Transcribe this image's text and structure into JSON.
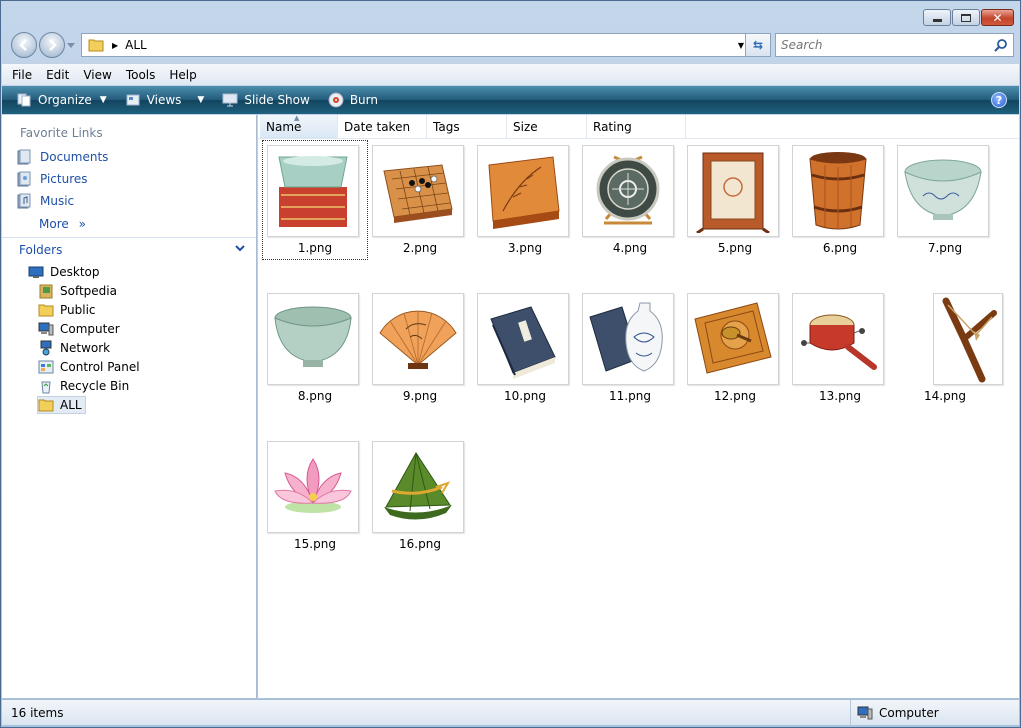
{
  "address": {
    "path": "ALL"
  },
  "search": {
    "placeholder": "Search"
  },
  "menu": [
    "File",
    "Edit",
    "View",
    "Tools",
    "Help"
  ],
  "toolbar": {
    "organize": "Organize",
    "views": "Views",
    "slideshow": "Slide Show",
    "burn": "Burn"
  },
  "favorites": {
    "title": "Favorite Links",
    "items": [
      {
        "label": "Documents",
        "icon": "documents-icon"
      },
      {
        "label": "Pictures",
        "icon": "pictures-icon"
      },
      {
        "label": "Music",
        "icon": "music-icon"
      }
    ],
    "more": "More"
  },
  "folders": {
    "title": "Folders",
    "tree": [
      {
        "label": "Desktop",
        "icon": "desktop-icon"
      },
      {
        "label": "Softpedia",
        "icon": "folder-icon"
      },
      {
        "label": "Public",
        "icon": "folder-icon"
      },
      {
        "label": "Computer",
        "icon": "computer-icon"
      },
      {
        "label": "Network",
        "icon": "network-icon"
      },
      {
        "label": "Control Panel",
        "icon": "control-panel-icon"
      },
      {
        "label": "Recycle Bin",
        "icon": "recycle-bin-icon"
      },
      {
        "label": "ALL",
        "icon": "folder-icon"
      }
    ]
  },
  "columns": [
    "Name",
    "Date taken",
    "Tags",
    "Size",
    "Rating"
  ],
  "files": [
    {
      "name": "1.png",
      "icon": "jade-box-icon"
    },
    {
      "name": "2.png",
      "icon": "go-board-icon"
    },
    {
      "name": "3.png",
      "icon": "lacquer-box-icon"
    },
    {
      "name": "4.png",
      "icon": "decorative-plate-icon"
    },
    {
      "name": "5.png",
      "icon": "wooden-frame-icon"
    },
    {
      "name": "6.png",
      "icon": "wooden-bucket-icon"
    },
    {
      "name": "7.png",
      "icon": "porcelain-bowl-icon"
    },
    {
      "name": "8.png",
      "icon": "celadon-bowl-icon"
    },
    {
      "name": "9.png",
      "icon": "folding-fan-icon"
    },
    {
      "name": "10.png",
      "icon": "book-icon"
    },
    {
      "name": "11.png",
      "icon": "book-and-vase-icon"
    },
    {
      "name": "12.png",
      "icon": "compass-icon"
    },
    {
      "name": "13.png",
      "icon": "drum-icon"
    },
    {
      "name": "14.png",
      "icon": "slingshot-icon"
    },
    {
      "name": "15.png",
      "icon": "lotus-icon"
    },
    {
      "name": "16.png",
      "icon": "rice-dumpling-icon"
    }
  ],
  "status": {
    "count": "16 items",
    "zone": "Computer"
  },
  "colors": {
    "accent": "#1e4fa8",
    "commandbar": "#215a7a"
  }
}
